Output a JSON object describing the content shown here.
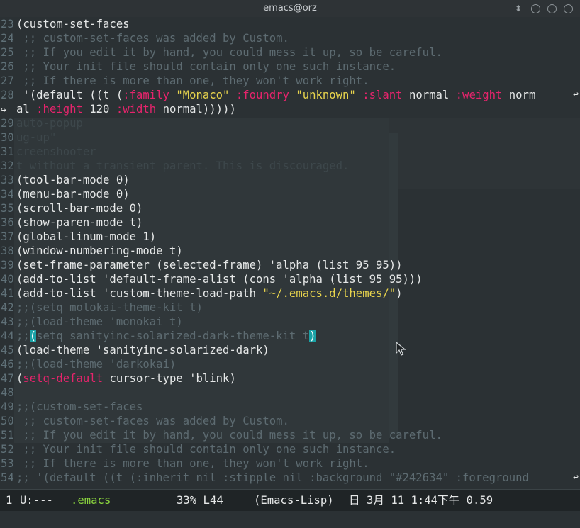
{
  "window": {
    "title": "emacs@orz",
    "arrow_glyph": "⬍"
  },
  "lines": [
    {
      "n": "23",
      "segs": [
        {
          "t": "(custom-set-faces",
          "k": "n"
        }
      ]
    },
    {
      "n": "24",
      "segs": [
        {
          "t": " ;; custom-set-faces was added by Custom.",
          "k": "c"
        }
      ]
    },
    {
      "n": "25",
      "segs": [
        {
          "t": " ;; If you edit it by hand, you could mess it up, so be careful.",
          "k": "c"
        }
      ]
    },
    {
      "n": "26",
      "segs": [
        {
          "t": " ;; Your init file should contain only one such instance.",
          "k": "c"
        }
      ]
    },
    {
      "n": "27",
      "segs": [
        {
          "t": " ;; If there is more than one, they won't work right.",
          "k": "c"
        }
      ]
    },
    {
      "n": "28",
      "wrap": true,
      "segs": [
        {
          "t": " '(default ((t (",
          "k": "n"
        },
        {
          "t": ":family",
          "k": "kw"
        },
        {
          "t": " ",
          "k": "n"
        },
        {
          "t": "\"Monaco\"",
          "k": "str"
        },
        {
          "t": " ",
          "k": "n"
        },
        {
          "t": ":foundry",
          "k": "kw"
        },
        {
          "t": " ",
          "k": "n"
        },
        {
          "t": "\"unknown\"",
          "k": "str"
        },
        {
          "t": " ",
          "k": "n"
        },
        {
          "t": ":slant",
          "k": "kw"
        },
        {
          "t": " normal ",
          "k": "n"
        },
        {
          "t": ":weight",
          "k": "kw"
        },
        {
          "t": " norm",
          "k": "n"
        }
      ]
    },
    {
      "n": "",
      "cont": true,
      "segs": [
        {
          "t": "al ",
          "k": "n"
        },
        {
          "t": ":height",
          "k": "kw"
        },
        {
          "t": " 120 ",
          "k": "n"
        },
        {
          "t": ":width",
          "k": "kw"
        },
        {
          "t": " normal)))))",
          "k": "n"
        }
      ]
    },
    {
      "n": "29",
      "segs": [
        {
          "t": "auto-popup",
          "k": "g"
        }
      ]
    },
    {
      "n": "30",
      "segs": [
        {
          "t": "ug-up\"",
          "k": "g"
        }
      ]
    },
    {
      "n": "31",
      "segs": [
        {
          "t": "creenshooter",
          "k": "g"
        }
      ]
    },
    {
      "n": "32",
      "segs": [
        {
          "t": "t without a transient parent. This is discouraged.",
          "k": "g"
        }
      ]
    },
    {
      "n": "33",
      "segs": [
        {
          "t": "(tool-bar-mode 0)",
          "k": "n"
        }
      ]
    },
    {
      "n": "34",
      "segs": [
        {
          "t": "(menu-bar-mode 0)",
          "k": "n"
        }
      ]
    },
    {
      "n": "35",
      "segs": [
        {
          "t": "(scroll-bar-mode 0)",
          "k": "n"
        }
      ]
    },
    {
      "n": "36",
      "segs": [
        {
          "t": "(show-paren-mode t)",
          "k": "n"
        }
      ]
    },
    {
      "n": "37",
      "segs": [
        {
          "t": "(global-linum-mode 1)",
          "k": "n"
        }
      ]
    },
    {
      "n": "38",
      "segs": [
        {
          "t": "(window-numbering-mode t)",
          "k": "n"
        }
      ]
    },
    {
      "n": "39",
      "segs": [
        {
          "t": "(set-frame-parameter (selected-frame) 'alpha (list 95 95))",
          "k": "n"
        }
      ]
    },
    {
      "n": "40",
      "segs": [
        {
          "t": "(add-to-list 'default-frame-alist (cons 'alpha (list 95 95)))",
          "k": "n"
        }
      ]
    },
    {
      "n": "41",
      "segs": [
        {
          "t": "(add-to-list 'custom-theme-load-path ",
          "k": "n"
        },
        {
          "t": "\"~/.emacs.d/themes/\"",
          "k": "str"
        },
        {
          "t": ")",
          "k": "n"
        }
      ]
    },
    {
      "n": "42",
      "segs": [
        {
          "t": ";;(setq molokai-theme-kit t)",
          "k": "c"
        }
      ]
    },
    {
      "n": "43",
      "segs": [
        {
          "t": ";;(load-theme 'monokai t)",
          "k": "c"
        }
      ]
    },
    {
      "n": "44",
      "segs": [
        {
          "t": ";;",
          "k": "c"
        },
        {
          "t": "(",
          "k": "brk"
        },
        {
          "t": "setq sanityinc-solarized-dark-theme-kit t",
          "k": "c"
        },
        {
          "t": ")",
          "k": "brk"
        }
      ]
    },
    {
      "n": "45",
      "segs": [
        {
          "t": "(load-theme 'sanityinc-solarized-dark)",
          "k": "n"
        }
      ]
    },
    {
      "n": "46",
      "segs": [
        {
          "t": ";;(load-theme 'darkokai)",
          "k": "c"
        }
      ]
    },
    {
      "n": "47",
      "segs": [
        {
          "t": "(",
          "k": "n"
        },
        {
          "t": "setq-default",
          "k": "kw"
        },
        {
          "t": " cursor-type 'blink)",
          "k": "n"
        }
      ]
    },
    {
      "n": "48",
      "segs": [
        {
          "t": "",
          "k": "n"
        }
      ]
    },
    {
      "n": "49",
      "segs": [
        {
          "t": ";;(custom-set-faces",
          "k": "c"
        }
      ]
    },
    {
      "n": "50",
      "segs": [
        {
          "t": " ;; custom-set-faces was added by Custom.",
          "k": "c"
        }
      ]
    },
    {
      "n": "51",
      "segs": [
        {
          "t": " ;; If you edit it by hand, you could mess it up, so be careful.",
          "k": "c"
        }
      ]
    },
    {
      "n": "52",
      "segs": [
        {
          "t": " ;; Your init file should contain only one such instance.",
          "k": "c"
        }
      ]
    },
    {
      "n": "53",
      "segs": [
        {
          "t": " ;; If there is more than one, they won't work right.",
          "k": "c"
        }
      ]
    },
    {
      "n": "54",
      "wrap": true,
      "segs": [
        {
          "t": ";; '(default ((t (:inherit nil :stipple nil :background \"#242634\" :foreground ",
          "k": "c"
        }
      ]
    }
  ],
  "modeline": {
    "window_num": "1",
    "status": "U:---",
    "buffer": ".emacs",
    "position": "33% L44",
    "mode": "(Emacs-Lisp)",
    "datetime": "日 3月 11 1:44下午 0.59"
  },
  "colors": {
    "keyword": "#e6246c",
    "string": "#e8d44d",
    "comment": "#5d6b71",
    "paren_match": "#1aa2a6",
    "buffer_name": "#8ad43e"
  }
}
